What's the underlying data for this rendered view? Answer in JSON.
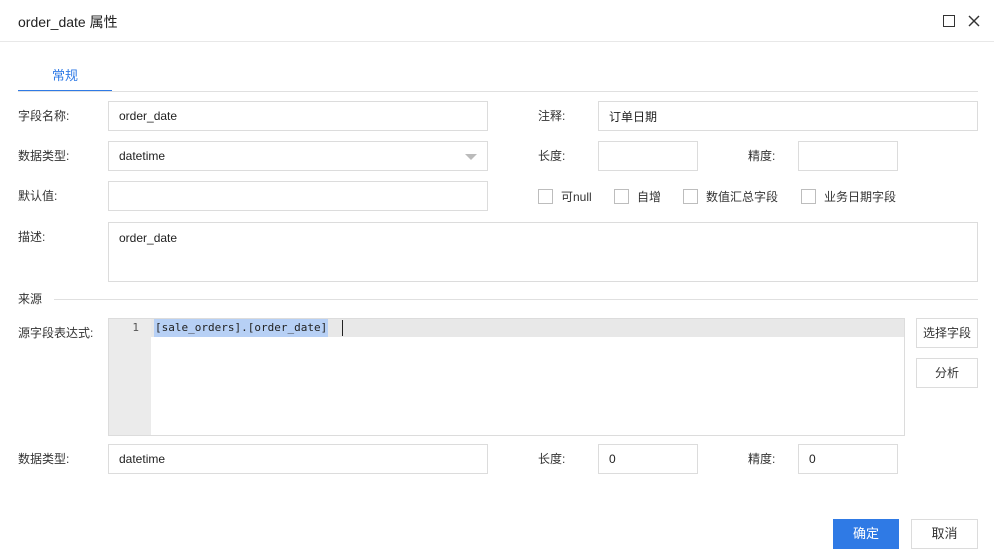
{
  "dialog": {
    "title": "order_date 属性",
    "maximize_icon": "maximize-icon",
    "close_icon": "close-icon"
  },
  "tabs": [
    {
      "label": "常规",
      "active": true
    }
  ],
  "form": {
    "field_name_label": "字段名称:",
    "field_name_value": "order_date",
    "comment_label": "注释:",
    "comment_value": "订单日期",
    "data_type_label": "数据类型:",
    "data_type_value": "datetime",
    "length_label": "长度:",
    "length_value": "",
    "precision_label": "精度:",
    "precision_value": "",
    "default_label": "默认值:",
    "default_value": "",
    "checkboxes": [
      {
        "label": "可null",
        "checked": false
      },
      {
        "label": "自增",
        "checked": false
      },
      {
        "label": "数值汇总字段",
        "checked": false
      },
      {
        "label": "业务日期字段",
        "checked": false
      }
    ],
    "desc_label": "描述:",
    "desc_value": "order_date"
  },
  "source": {
    "section_title": "来源",
    "expr_label": "源字段表达式:",
    "line_number": "1",
    "expression": "[sale_orders].[order_date]",
    "select_field_button": "选择字段",
    "analyze_button": "分析",
    "data_type_label": "数据类型:",
    "data_type_value": "datetime",
    "length_label": "长度:",
    "length_value": "0",
    "precision_label": "精度:",
    "precision_value": "0"
  },
  "footer": {
    "ok_button": "确定",
    "cancel_button": "取消"
  },
  "colors": {
    "accent": "#2f7ae5",
    "selection": "#b7d0f5"
  }
}
